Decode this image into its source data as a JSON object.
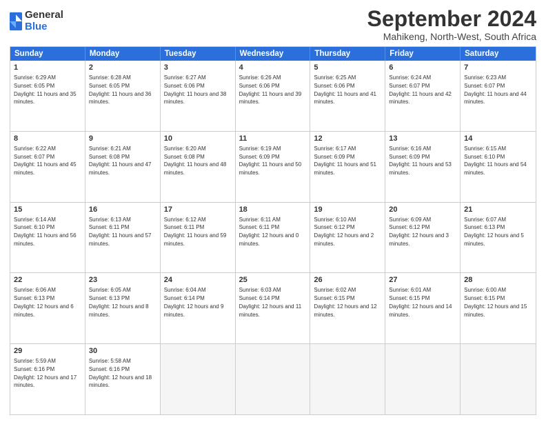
{
  "header": {
    "logo": {
      "line1": "General",
      "line2": "Blue"
    },
    "title": "September 2024",
    "location": "Mahikeng, North-West, South Africa"
  },
  "calendar": {
    "days": [
      "Sunday",
      "Monday",
      "Tuesday",
      "Wednesday",
      "Thursday",
      "Friday",
      "Saturday"
    ],
    "rows": [
      [
        {
          "num": "1",
          "sunrise": "6:29 AM",
          "sunset": "6:05 PM",
          "daylight": "11 hours and 35 minutes."
        },
        {
          "num": "2",
          "sunrise": "6:28 AM",
          "sunset": "6:05 PM",
          "daylight": "11 hours and 36 minutes."
        },
        {
          "num": "3",
          "sunrise": "6:27 AM",
          "sunset": "6:06 PM",
          "daylight": "11 hours and 38 minutes."
        },
        {
          "num": "4",
          "sunrise": "6:26 AM",
          "sunset": "6:06 PM",
          "daylight": "11 hours and 39 minutes."
        },
        {
          "num": "5",
          "sunrise": "6:25 AM",
          "sunset": "6:06 PM",
          "daylight": "11 hours and 41 minutes."
        },
        {
          "num": "6",
          "sunrise": "6:24 AM",
          "sunset": "6:07 PM",
          "daylight": "11 hours and 42 minutes."
        },
        {
          "num": "7",
          "sunrise": "6:23 AM",
          "sunset": "6:07 PM",
          "daylight": "11 hours and 44 minutes."
        }
      ],
      [
        {
          "num": "8",
          "sunrise": "6:22 AM",
          "sunset": "6:07 PM",
          "daylight": "11 hours and 45 minutes."
        },
        {
          "num": "9",
          "sunrise": "6:21 AM",
          "sunset": "6:08 PM",
          "daylight": "11 hours and 47 minutes."
        },
        {
          "num": "10",
          "sunrise": "6:20 AM",
          "sunset": "6:08 PM",
          "daylight": "11 hours and 48 minutes."
        },
        {
          "num": "11",
          "sunrise": "6:19 AM",
          "sunset": "6:09 PM",
          "daylight": "11 hours and 50 minutes."
        },
        {
          "num": "12",
          "sunrise": "6:17 AM",
          "sunset": "6:09 PM",
          "daylight": "11 hours and 51 minutes."
        },
        {
          "num": "13",
          "sunrise": "6:16 AM",
          "sunset": "6:09 PM",
          "daylight": "11 hours and 53 minutes."
        },
        {
          "num": "14",
          "sunrise": "6:15 AM",
          "sunset": "6:10 PM",
          "daylight": "11 hours and 54 minutes."
        }
      ],
      [
        {
          "num": "15",
          "sunrise": "6:14 AM",
          "sunset": "6:10 PM",
          "daylight": "11 hours and 56 minutes."
        },
        {
          "num": "16",
          "sunrise": "6:13 AM",
          "sunset": "6:11 PM",
          "daylight": "11 hours and 57 minutes."
        },
        {
          "num": "17",
          "sunrise": "6:12 AM",
          "sunset": "6:11 PM",
          "daylight": "11 hours and 59 minutes."
        },
        {
          "num": "18",
          "sunrise": "6:11 AM",
          "sunset": "6:11 PM",
          "daylight": "12 hours and 0 minutes."
        },
        {
          "num": "19",
          "sunrise": "6:10 AM",
          "sunset": "6:12 PM",
          "daylight": "12 hours and 2 minutes."
        },
        {
          "num": "20",
          "sunrise": "6:09 AM",
          "sunset": "6:12 PM",
          "daylight": "12 hours and 3 minutes."
        },
        {
          "num": "21",
          "sunrise": "6:07 AM",
          "sunset": "6:13 PM",
          "daylight": "12 hours and 5 minutes."
        }
      ],
      [
        {
          "num": "22",
          "sunrise": "6:06 AM",
          "sunset": "6:13 PM",
          "daylight": "12 hours and 6 minutes."
        },
        {
          "num": "23",
          "sunrise": "6:05 AM",
          "sunset": "6:13 PM",
          "daylight": "12 hours and 8 minutes."
        },
        {
          "num": "24",
          "sunrise": "6:04 AM",
          "sunset": "6:14 PM",
          "daylight": "12 hours and 9 minutes."
        },
        {
          "num": "25",
          "sunrise": "6:03 AM",
          "sunset": "6:14 PM",
          "daylight": "12 hours and 11 minutes."
        },
        {
          "num": "26",
          "sunrise": "6:02 AM",
          "sunset": "6:15 PM",
          "daylight": "12 hours and 12 minutes."
        },
        {
          "num": "27",
          "sunrise": "6:01 AM",
          "sunset": "6:15 PM",
          "daylight": "12 hours and 14 minutes."
        },
        {
          "num": "28",
          "sunrise": "6:00 AM",
          "sunset": "6:15 PM",
          "daylight": "12 hours and 15 minutes."
        }
      ],
      [
        {
          "num": "29",
          "sunrise": "5:59 AM",
          "sunset": "6:16 PM",
          "daylight": "12 hours and 17 minutes."
        },
        {
          "num": "30",
          "sunrise": "5:58 AM",
          "sunset": "6:16 PM",
          "daylight": "12 hours and 18 minutes."
        },
        {
          "num": "",
          "sunrise": "",
          "sunset": "",
          "daylight": ""
        },
        {
          "num": "",
          "sunrise": "",
          "sunset": "",
          "daylight": ""
        },
        {
          "num": "",
          "sunrise": "",
          "sunset": "",
          "daylight": ""
        },
        {
          "num": "",
          "sunrise": "",
          "sunset": "",
          "daylight": ""
        },
        {
          "num": "",
          "sunrise": "",
          "sunset": "",
          "daylight": ""
        }
      ]
    ]
  }
}
